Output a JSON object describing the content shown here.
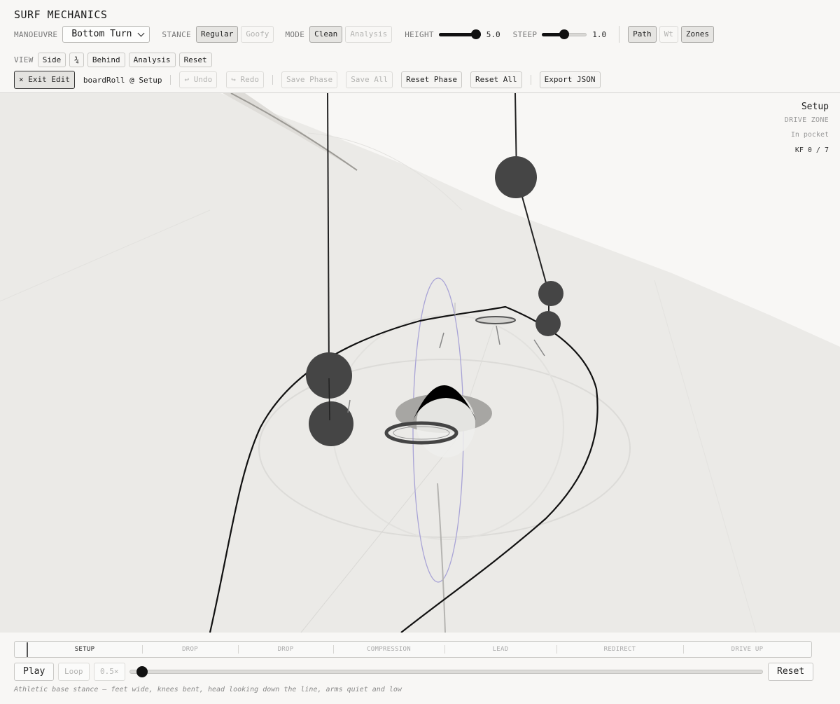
{
  "app": {
    "title": "SURF MECHANICS"
  },
  "controls": {
    "manoeuvre": {
      "label": "MANOEUVRE",
      "selected": "Bottom Turn"
    },
    "stance": {
      "label": "STANCE",
      "options": [
        "Regular",
        "Goofy"
      ],
      "active": "Regular"
    },
    "mode": {
      "label": "MODE",
      "options": [
        "Clean",
        "Analysis"
      ],
      "active": "Clean"
    },
    "height": {
      "label": "HEIGHT",
      "value": "5.0",
      "fraction": 1.0
    },
    "steep": {
      "label": "STEEP",
      "value": "1.0",
      "fraction": 0.5
    },
    "toggles": [
      "Path",
      "Wt",
      "Zones"
    ]
  },
  "view": {
    "label": "VIEW",
    "options": [
      "Side",
      "¾",
      "Behind",
      "Analysis",
      "Reset"
    ]
  },
  "edit": {
    "exit_label": "× Exit Edit",
    "target": "boardRoll @ Setup",
    "undo": "↩ Undo",
    "redo": "↪ Redo",
    "save_phase": "Save Phase",
    "save_all": "Save All",
    "reset_phase": "Reset Phase",
    "reset_all": "Reset All",
    "export": "Export JSON"
  },
  "hud": {
    "phase": "Setup",
    "zone": "DRIVE ZONE",
    "pocket": "In pocket",
    "keyframe": "KF 0 / 7"
  },
  "timeline": {
    "phases": [
      "SETUP",
      "DROP",
      "DROP",
      "COMPRESSION",
      "LEAD",
      "REDIRECT",
      "DRIVE UP"
    ],
    "active_index": 0
  },
  "playback": {
    "play": "Play",
    "loop": "Loop",
    "speed": "0.5×",
    "reset": "Reset",
    "progress": 0.02,
    "caption": "Athletic base stance — feet wide, knees bent, head looking down the line, arms quiet and low"
  },
  "colors": {
    "accent": "#111111",
    "background": "#f8f7f5",
    "viewport": "#ebeae7",
    "board_axis": "#a8a3d6"
  }
}
